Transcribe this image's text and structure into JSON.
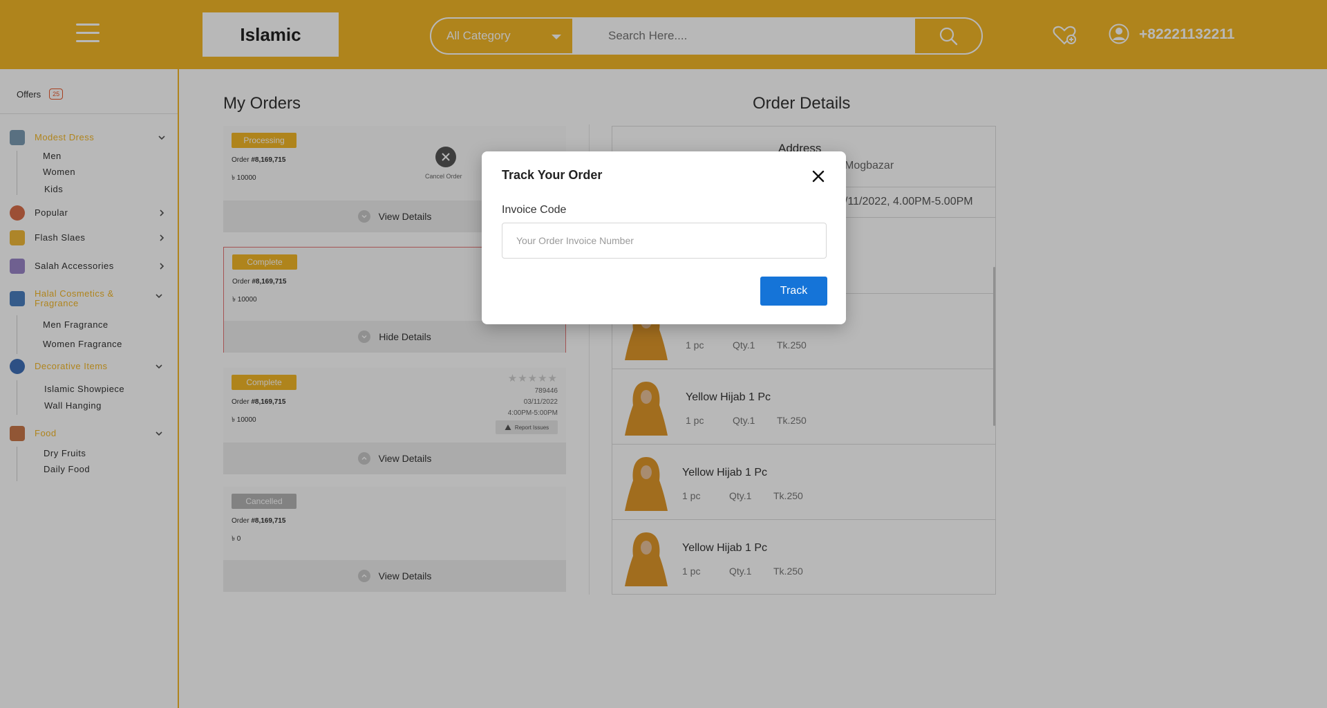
{
  "header": {
    "logo": "Islamic",
    "category_select": "All Category",
    "search_placeholder": "Search Here....",
    "phone": "+82221132211"
  },
  "sidebar": {
    "offers_label": "Offers",
    "offers_count": "25",
    "categories": [
      {
        "label": "Modest Dress",
        "active": true,
        "subitems": [
          "Men",
          "Women",
          "Kids"
        ]
      },
      {
        "label": "Popular",
        "active": false,
        "subitems": []
      },
      {
        "label": "Flash Slaes",
        "active": false,
        "subitems": []
      },
      {
        "label": "Salah Accessories",
        "active": false,
        "subitems": []
      },
      {
        "label": "Halal Cosmetics & Fragrance",
        "active": true,
        "subitems": [
          "Men Fragrance",
          "Women Fragrance"
        ]
      },
      {
        "label": "Decorative Items",
        "active": true,
        "subitems": [
          "Islamic Showpiece",
          "Wall Hanging"
        ]
      },
      {
        "label": "Food",
        "active": true,
        "subitems": [
          "Dry Fruits",
          "Daily Food"
        ]
      }
    ]
  },
  "my_orders": {
    "title": "My Orders",
    "orders": [
      {
        "status": "Processing",
        "order_label": "Order",
        "order_no": "#8,169,715",
        "amount": "৳ 10000",
        "action": "Cancel Order",
        "button": "View Details"
      },
      {
        "status": "Complete",
        "order_label": "Order",
        "order_no": "#8,169,715",
        "amount": "৳ 10000",
        "button": "Hide Details"
      },
      {
        "status": "Complete",
        "order_label": "Order",
        "order_no": "#8,169,715",
        "amount": "৳ 10000",
        "invoice": "789446",
        "date": "03/11/2022",
        "time": "4:00PM-5:00PM",
        "report": "Report Issues",
        "rating": 0,
        "button": "View Details"
      },
      {
        "status": "Cancelled",
        "order_label": "Order",
        "order_no": "#8,169,715",
        "amount": "৳ 0",
        "button": "View Details"
      }
    ]
  },
  "order_details": {
    "title": "Order Details",
    "address_title": "Address",
    "address_text": "Mogbazar",
    "delivery_time": "/11/2022, 4.00PM-5.00PM",
    "items": [
      {
        "name": "",
        "pcs": "1 pc",
        "qty": "Qty.1",
        "price": "Tk.250"
      },
      {
        "name": "Yellow Hijab 1 Pc",
        "pcs": "1 pc",
        "qty": "Qty.1",
        "price": "Tk.250"
      },
      {
        "name": "Yellow Hijab 1 Pc",
        "pcs": "1 pc",
        "qty": "Qty.1",
        "price": "Tk.250"
      },
      {
        "name": "Yellow Hijab 1 Pc",
        "pcs": "1 pc",
        "qty": "Qty.1",
        "price": "Tk.250"
      }
    ]
  },
  "modal": {
    "title": "Track Your Order",
    "label": "Invoice Code",
    "placeholder": "Your Order Invoice Number",
    "button": "Track"
  },
  "colors": {
    "brand": "#f3b728",
    "processing": "#f3b728",
    "complete": "#f3b728",
    "cancelled": "#b5b5b5",
    "track_button": "#1574d8"
  }
}
